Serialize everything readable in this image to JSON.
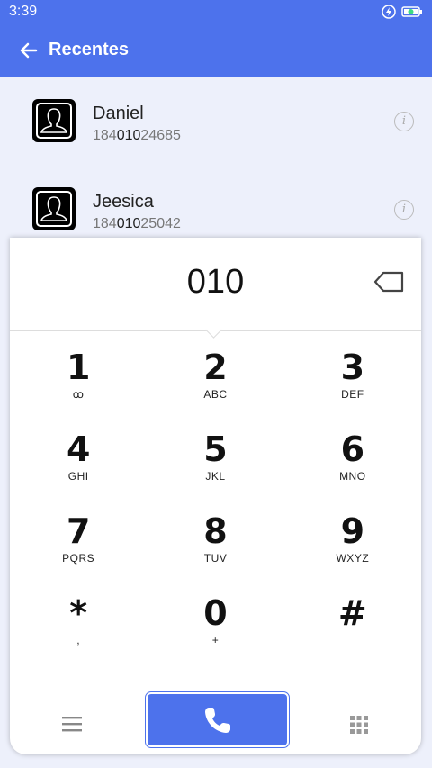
{
  "status": {
    "time": "3:39"
  },
  "appbar": {
    "title": "Recentes"
  },
  "contacts": [
    {
      "name": "Daniel",
      "number_prefix": "184",
      "number_match": "010",
      "number_suffix": "24685"
    },
    {
      "name": "Jeesica",
      "number_prefix": "184",
      "number_match": "010",
      "number_suffix": "25042"
    }
  ],
  "dialer": {
    "display": "010",
    "keys": [
      {
        "digit": "1",
        "letters": "ꝏ"
      },
      {
        "digit": "2",
        "letters": "ABC"
      },
      {
        "digit": "3",
        "letters": "DEF"
      },
      {
        "digit": "4",
        "letters": "GHI"
      },
      {
        "digit": "5",
        "letters": "JKL"
      },
      {
        "digit": "6",
        "letters": "MNO"
      },
      {
        "digit": "7",
        "letters": "PQRS"
      },
      {
        "digit": "8",
        "letters": "TUV"
      },
      {
        "digit": "9",
        "letters": "WXYZ"
      },
      {
        "digit": "*",
        "letters": ","
      },
      {
        "digit": "0",
        "letters": "+"
      },
      {
        "digit": "#",
        "letters": ""
      }
    ]
  },
  "colors": {
    "accent": "#4d72ec",
    "background": "#edf0fb"
  },
  "icons": [
    "back-arrow-icon",
    "bolt-icon",
    "battery-icon",
    "info-icon",
    "backspace-icon",
    "menu-icon",
    "phone-icon",
    "dialpad-icon"
  ]
}
